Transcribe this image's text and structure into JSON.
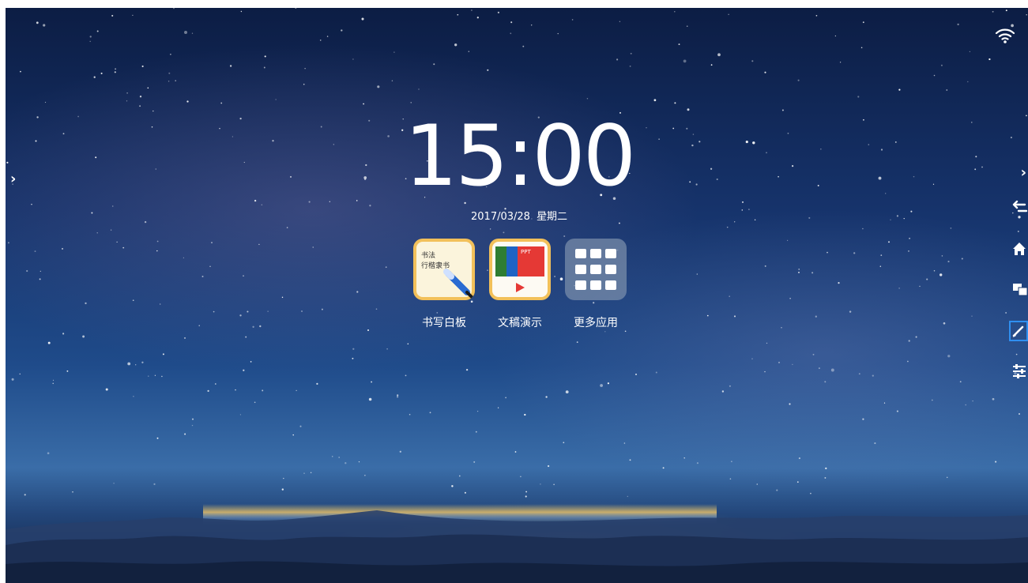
{
  "status_bar": {
    "wifi_icon": "wifi-icon"
  },
  "clock": {
    "time": "15:00",
    "date": "2017/03/28",
    "weekday": "星期二"
  },
  "apps": [
    {
      "label": "书写白板",
      "icon": "whiteboard-icon"
    },
    {
      "label": "文稿演示",
      "icon": "presentation-icon"
    },
    {
      "label": "更多应用",
      "icon": "more-apps-grid-icon"
    }
  ],
  "whiteboard_icon_text": [
    "书法",
    "行楷隶书"
  ],
  "presentation_icon_text": [
    "PPT"
  ],
  "edge_controls": {
    "left_arrow": "›",
    "right_arrow": "›"
  },
  "side_toolbar": [
    {
      "icon": "back-icon"
    },
    {
      "icon": "home-icon"
    },
    {
      "icon": "screen-display-icon"
    },
    {
      "icon": "annotate-pen-icon"
    },
    {
      "icon": "settings-sliders-icon"
    }
  ],
  "colors": {
    "sky_top": "#0c1d44",
    "sky_mid": "#1f4b8a",
    "horizon_glow": "#ffc850",
    "text": "#ffffff",
    "toolbar_highlight": "#1e88e5"
  }
}
